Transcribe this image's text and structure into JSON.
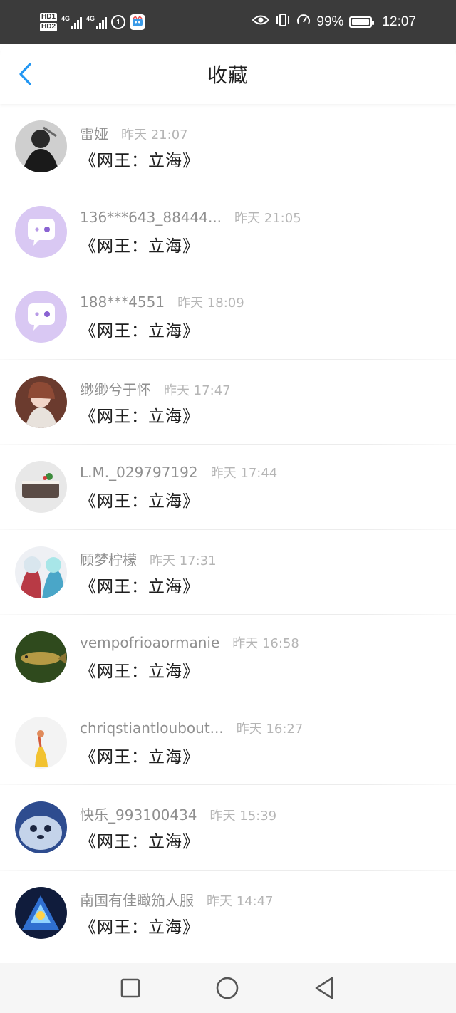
{
  "status_bar": {
    "hd1": "HD1",
    "hd2": "HD2",
    "net1": "4G",
    "net2": "4G",
    "badge_text": "1",
    "battery": "99%",
    "battery_level": 0.99,
    "time": "12:07"
  },
  "header": {
    "title": "收藏",
    "back_icon": "chevron-left-icon",
    "accent_color": "#2196f3"
  },
  "favorites": [
    {
      "username": "雷娅",
      "time": "昨天 21:07",
      "title": "《网王：立海》",
      "avatar": "photo"
    },
    {
      "username": "136***643_88444...",
      "time": "昨天 21:05",
      "title": "《网王：立海》",
      "avatar": "default-chat"
    },
    {
      "username": "188***4551",
      "time": "昨天 18:09",
      "title": "《网王：立海》",
      "avatar": "default-chat"
    },
    {
      "username": "缈缈兮于怀",
      "time": "昨天 17:47",
      "title": "《网王：立海》",
      "avatar": "photo"
    },
    {
      "username": "L.M._029797192",
      "time": "昨天 17:44",
      "title": "《网王：立海》",
      "avatar": "photo"
    },
    {
      "username": "顾梦柠檬",
      "time": "昨天 17:31",
      "title": "《网王：立海》",
      "avatar": "photo"
    },
    {
      "username": "vempofrioaormanie",
      "time": "昨天 16:58",
      "title": "《网王：立海》",
      "avatar": "photo"
    },
    {
      "username": "chriqstiantloubout...",
      "time": "昨天 16:27",
      "title": "《网王：立海》",
      "avatar": "photo"
    },
    {
      "username": "快乐_993100434",
      "time": "昨天 15:39",
      "title": "《网王：立海》",
      "avatar": "photo"
    },
    {
      "username": "南国有佳瞰笳人服",
      "time": "昨天 14:47",
      "title": "《网王：立海》",
      "avatar": "photo"
    }
  ],
  "nav_bar": {
    "recent_icon": "square-icon",
    "home_icon": "circle-icon",
    "back_icon": "triangle-back-icon"
  },
  "colors": {
    "status_bg": "#3b3b3b",
    "default_avatar": "#d9c8f3"
  }
}
